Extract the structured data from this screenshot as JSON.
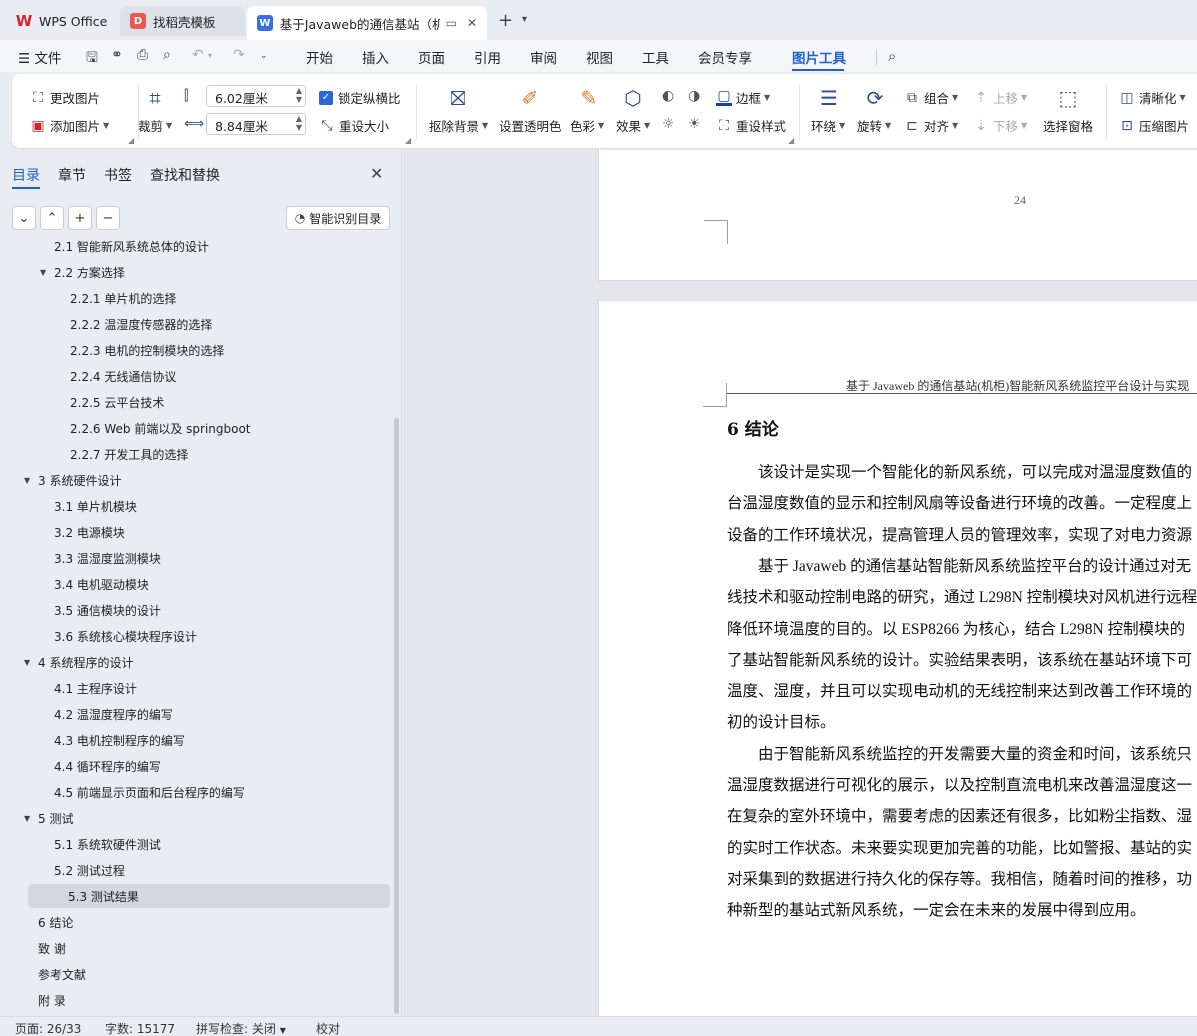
{
  "titlebar": {
    "tabs": [
      {
        "label": "WPS Office",
        "icon": "wps-logo-icon"
      },
      {
        "label": "找稻壳模板",
        "icon": "docer-icon"
      },
      {
        "label": "基于Javaweb的通信基站（机柜",
        "icon": "word-doc-icon"
      }
    ],
    "new_tab": "+",
    "new_tab_menu": "⌄"
  },
  "menubar": {
    "file": "文件",
    "tabs": [
      "开始",
      "插入",
      "页面",
      "引用",
      "审阅",
      "视图",
      "工具",
      "会员专享",
      "图片工具"
    ],
    "active_tab": "图片工具"
  },
  "ribbon": {
    "change_picture": "更改图片",
    "add_picture": "添加图片",
    "crop": "裁剪",
    "height_value": "6.02厘米",
    "width_value": "8.84厘米",
    "lock_ratio": "锁定纵横比",
    "reset_size": "重设大小",
    "remove_bg": "抠除背景",
    "set_transparent": "设置透明色",
    "color": "色彩",
    "effect": "效果",
    "border": "边框",
    "reset_style": "重设样式",
    "wrap": "环绕",
    "rotate": "旋转",
    "group": "组合",
    "align": "对齐",
    "bring_forward": "上移",
    "send_backward": "下移",
    "selection_pane": "选择窗格",
    "sharpen": "清晰化",
    "compress": "压缩图片"
  },
  "nav": {
    "tabs": [
      "目录",
      "章节",
      "书签",
      "查找和替换"
    ],
    "active_tab": "目录",
    "smart_toc": "智能识别目录",
    "items": [
      {
        "text": "2.1  智能新风系统总体的设计",
        "level": 2,
        "expand": ""
      },
      {
        "text": "2.2  方案选择",
        "level": 2,
        "expand": "▼"
      },
      {
        "text": "2.2.1  单片机的选择",
        "level": 3,
        "expand": ""
      },
      {
        "text": "2.2.2  温湿度传感器的选择",
        "level": 3,
        "expand": ""
      },
      {
        "text": "2.2.3  电机的控制模块的选择",
        "level": 3,
        "expand": ""
      },
      {
        "text": "2.2.4  无线通信协议",
        "level": 3,
        "expand": ""
      },
      {
        "text": "2.2.5 云平台技术",
        "level": 3,
        "expand": ""
      },
      {
        "text": "2.2.6 Web 前端以及 springboot",
        "level": 3,
        "expand": ""
      },
      {
        "text": "2.2.7  开发工具的选择",
        "level": 3,
        "expand": ""
      },
      {
        "text": "3  系统硬件设计",
        "level": 1,
        "expand": "▼"
      },
      {
        "text": "3.1  单片机模块",
        "level": 2,
        "expand": ""
      },
      {
        "text": "3.2  电源模块",
        "level": 2,
        "expand": ""
      },
      {
        "text": "3.3  温湿度监测模块",
        "level": 2,
        "expand": ""
      },
      {
        "text": "3.4  电机驱动模块",
        "level": 2,
        "expand": ""
      },
      {
        "text": "3.5  通信模块的设计",
        "level": 2,
        "expand": ""
      },
      {
        "text": "3.6  系统核心模块程序设计",
        "level": 2,
        "expand": ""
      },
      {
        "text": "4  系统程序的设计",
        "level": 1,
        "expand": "▼"
      },
      {
        "text": "4.1  主程序设计",
        "level": 2,
        "expand": ""
      },
      {
        "text": "4.2  温湿度程序的编写",
        "level": 2,
        "expand": ""
      },
      {
        "text": "4.3  电机控制程序的编写",
        "level": 2,
        "expand": ""
      },
      {
        "text": "4.4  循环程序的编写",
        "level": 2,
        "expand": ""
      },
      {
        "text": "4.5  前端显示页面和后台程序的编写",
        "level": 2,
        "expand": ""
      },
      {
        "text": "5  测试",
        "level": 1,
        "expand": "▼"
      },
      {
        "text": "5.1  系统软硬件测试",
        "level": 2,
        "expand": ""
      },
      {
        "text": "5.2  测试过程",
        "level": 2,
        "expand": ""
      },
      {
        "text": "5.3  测试结果",
        "level": 2,
        "expand": "",
        "selected": true
      },
      {
        "text": "6  结论",
        "level": 1,
        "expand": ""
      },
      {
        "text": "致  谢",
        "level": 1,
        "expand": ""
      },
      {
        "text": "参考文献",
        "level": 1,
        "expand": ""
      },
      {
        "text": "附  录",
        "level": 1,
        "expand": ""
      }
    ]
  },
  "document": {
    "prev_page_number": "24",
    "running_header": "基于 Javaweb 的通信基站(机柜)智能新风系统监控平台设计与实现",
    "heading": "6  结论",
    "lines": [
      "　　该设计是实现一个智能化的新风系统，可以完成对温湿度数值的",
      "台温湿度数值的显示和控制风扇等设备进行环境的改善。一定程度上",
      "设备的工作环境状况，提高管理人员的管理效率，实现了对电力资源",
      "　　基于 Javaweb 的通信基站智能新风系统监控平台的设计通过对无",
      "线技术和驱动控制电路的研究，通过 L298N 控制模块对风机进行远程",
      "降低环境温度的目的。以 ESP8266 为核心，结合 L298N 控制模块的",
      "了基站智能新风系统的设计。实验结果表明，该系统在基站环境下可",
      "温度、湿度，并且可以实现电动机的无线控制来达到改善工作环境的",
      "初的设计目标。",
      "　　由于智能新风系统监控的开发需要大量的资金和时间，该系统只",
      "温湿度数据进行可视化的展示，以及控制直流电机来改善温湿度这一",
      "在复杂的室外环境中，需要考虑的因素还有很多，比如粉尘指数、湿",
      "的实时工作状态。未来要实现更加完善的功能，比如警报、基站的实",
      "对采集到的数据进行持久化的保存等。我相信，随着时间的推移，功",
      "种新型的基站式新风系统，一定会在未来的发展中得到应用。"
    ]
  },
  "status": {
    "page": "页面: 26/33",
    "words": "字数: 15177",
    "spell": "拼写检查: 关闭",
    "proof": "校对"
  }
}
